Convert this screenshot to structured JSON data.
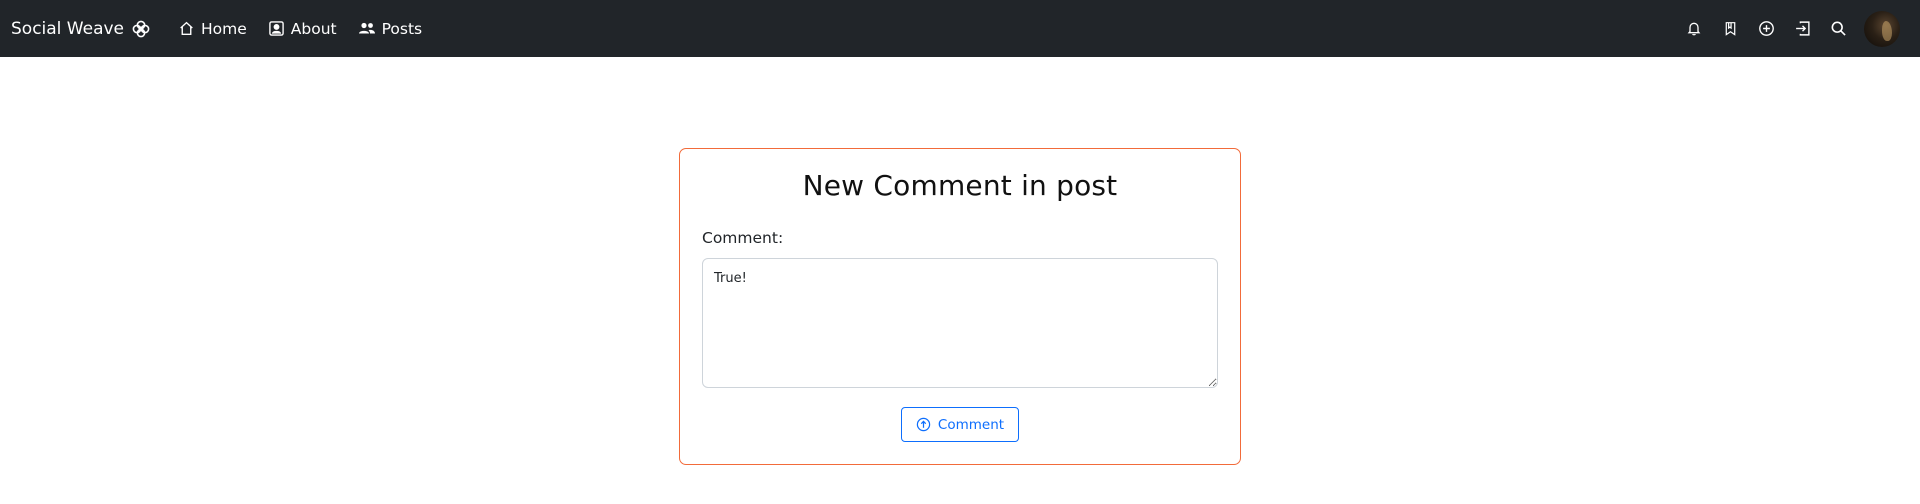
{
  "navbar": {
    "brand": "Social Weave",
    "brand_icon": "flower-icon",
    "links": [
      {
        "label": "Home",
        "icon": "house-icon"
      },
      {
        "label": "About",
        "icon": "person-badge-icon"
      },
      {
        "label": "Posts",
        "icon": "people-icon"
      }
    ],
    "right_icons": [
      "bell-icon",
      "bookmark-icon",
      "plus-circle-icon",
      "logout-icon",
      "search-icon"
    ],
    "background_color": "#212529"
  },
  "form": {
    "title": "New Comment in post",
    "comment_label": "Comment:",
    "comment_value": "True!",
    "submit_label": "Comment",
    "submit_icon": "arrow-up-circle-icon",
    "border_color": "#f26b3a",
    "accent_color": "#0d6efd"
  }
}
